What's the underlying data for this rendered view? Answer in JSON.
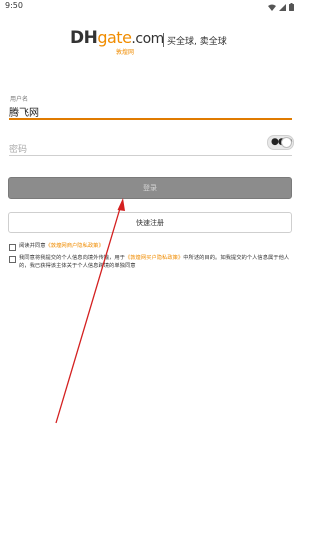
{
  "status_bar": {
    "time": "9:50"
  },
  "brand": {
    "logo_dh": "DH",
    "logo_gate": "gate",
    "logo_com": ".com",
    "logo_sub": "敦煌网",
    "slogan": "买全球, 卖全球"
  },
  "form": {
    "username_label": "用户名",
    "username_value": "腾飞网",
    "password_placeholder": "密码",
    "password_toggle_dots": "●●●"
  },
  "buttons": {
    "login_label": "登录",
    "register_label": "快速注册"
  },
  "agreements": {
    "terms_prefix": "阅读并同意",
    "terms_link": "《敦煌网商户隐私政策》",
    "privacy_prefix": "我同意将我提交的个人信息向境外传输，用于",
    "privacy_link": "《敦煌网买户隐私政策》",
    "privacy_suffix": "中所述的目的。如我提交的个人信息属于他人的，我已获得该主体关于个人信息跨境的单独同意"
  },
  "annotation": {
    "arrow_color": "#d42020"
  }
}
